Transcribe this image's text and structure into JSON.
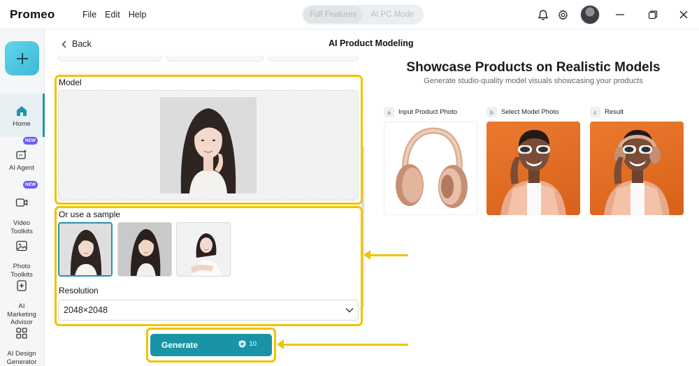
{
  "app": {
    "name": "Promeo"
  },
  "menu": [
    "File",
    "Edit",
    "Help"
  ],
  "modes": [
    "Full Features",
    "AI PC Mode"
  ],
  "sidebar": {
    "items": [
      {
        "label": "Home",
        "active": true
      },
      {
        "label": "AI Agent",
        "badge": "NEW"
      },
      {
        "label": "Video\nToolkits",
        "badge": "NEW"
      },
      {
        "label": "Photo\nToolkits"
      },
      {
        "label": "AI\nMarketing\nAdvisor"
      },
      {
        "label": "AI Design\nGenerator"
      }
    ]
  },
  "header": {
    "back": "Back",
    "title": "AI Product Modeling"
  },
  "model": {
    "label": "Model"
  },
  "samples": {
    "label": "Or use a sample",
    "count": 3,
    "selected_index": 0
  },
  "resolution": {
    "label": "Resolution",
    "value": "2048×2048"
  },
  "generate": {
    "label": "Generate",
    "credits": "10"
  },
  "showcase": {
    "title": "Showcase Products on Realistic Models",
    "subtitle": "Generate studio-quality model visuals showcasing your products",
    "steps": [
      {
        "badge": "a",
        "label": "Input Product Photo"
      },
      {
        "badge": "b",
        "label": "Select Model Photo"
      },
      {
        "badge": "c",
        "label": "Result"
      }
    ]
  },
  "colors": {
    "accent": "#1a93a6",
    "highlight": "#f2c200",
    "newBadge": "#6a5cf6",
    "orangeBackdrop": "#e2702a"
  }
}
